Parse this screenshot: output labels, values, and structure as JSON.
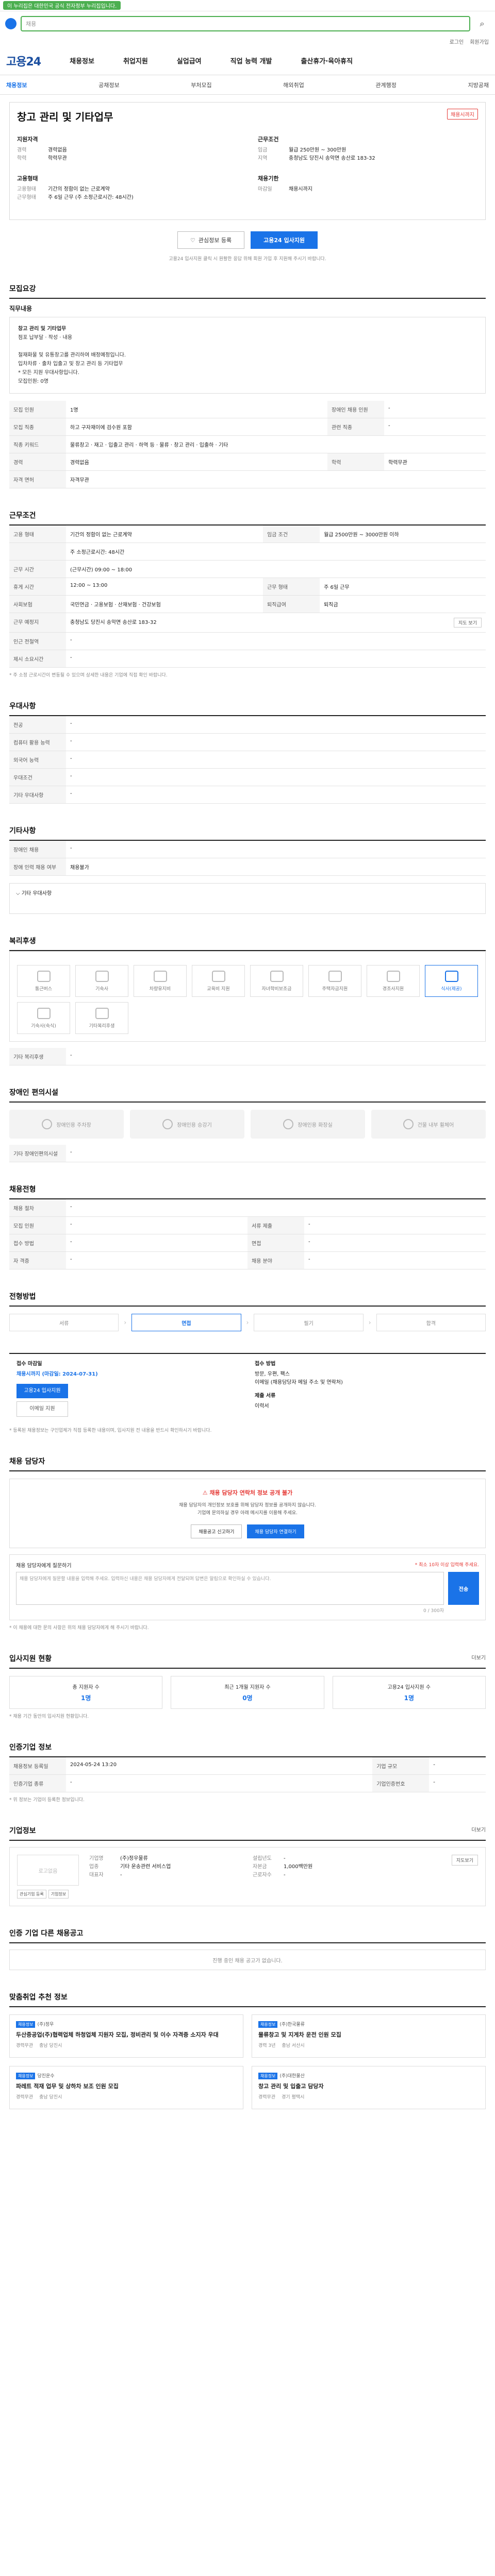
{
  "topbar": {
    "pill": "이 누리집은 대한민국 공식 전자정부 누리집입니다."
  },
  "search": {
    "placeholder": "채용"
  },
  "util": {
    "login": "로그인",
    "register": "회원가입"
  },
  "gnb": {
    "brand": "고용24",
    "menus": [
      "채용정보",
      "취업지원",
      "실업급여",
      "직업 능력 개발",
      "출산휴가·육아휴직"
    ]
  },
  "subnav": [
    "채용정보",
    "공채정보",
    "부처모집",
    "해외취업",
    "관계행정",
    "지방공채"
  ],
  "job": {
    "title": "창고 관리 및 기타업무",
    "badge": "채용시까지",
    "left_blocks": [
      {
        "head": "지원자격",
        "rows": [
          {
            "k": "경력",
            "v": "경력없음"
          },
          {
            "k": "학력",
            "v": "학력무관"
          }
        ]
      },
      {
        "head": "고용형태",
        "rows": [
          {
            "k": "고용형태",
            "v": "기간의 정함이 없는 근로계약"
          },
          {
            "k": "근무형태",
            "v": "주 6일 근무 (주 소정근로시간: 48시간)"
          }
        ]
      }
    ],
    "right_blocks": [
      {
        "head": "근무조건",
        "rows": [
          {
            "k": "임금",
            "v": "월급 250만원 ~ 300만원"
          },
          {
            "k": "지역",
            "v": "충청남도 당진시 송악면 송산로 183-32"
          }
        ]
      },
      {
        "head": "채용기한",
        "rows": [
          {
            "k": "마감일",
            "v": "채용시까지"
          }
        ]
      }
    ],
    "actions": {
      "scrap": "관심정보 등록",
      "apply": "고용24 입사지원"
    },
    "notice": "고용24 입사지원 클릭 시 원활한 응답 위해 회원 가입 후 지원해 주시기 바랍니다."
  },
  "sections": {
    "job_detail": {
      "title": "모집요강",
      "sub": "직무내용",
      "body": [
        "창고 관리 및 기타업무",
        "점포 납부달 · 작성 · 내용",
        "철재화물 및 유통창고를 관리하여 배정예정입니다.",
        "입차차류 · 출차 입출고 및 창고 관리 등 기타업무",
        "* 모든 지원 우대사항입니다.",
        "모집인원: 0명"
      ],
      "rows": [
        {
          "k": "모집 인원",
          "v": "1명",
          "k2": "장애인 채용 인원",
          "v2": "-"
        },
        {
          "k": "모집 직종",
          "v": "하고 구자재이에 검수원 포함",
          "k2": "관련 직종",
          "v2": "-"
        },
        {
          "k": "직종 키워드",
          "v": "물류창고 · 재고 · 입출고 관리 · 하역 등 · 물류 · 창고 관리 · 입출하 · 기타",
          "k2": "",
          "v2": ""
        },
        {
          "k": "경력",
          "v": "경력없음",
          "k2": "학력",
          "v2": "학력무관"
        },
        {
          "k": "자격 면허",
          "v": "자격무관",
          "k2": "",
          "v2": ""
        }
      ]
    },
    "conditions": {
      "title": "근무조건",
      "rows": [
        {
          "k": "고용 형태",
          "v": "기간의 정함이 없는 근로계약",
          "k2": "임금 조건",
          "v2": "월급 2500만원 ~ 3000만원 이하"
        },
        {
          "k": "",
          "v": "주 소정근로시간: 48시간",
          "k2": "",
          "v2": ""
        },
        {
          "k": "근무 시간",
          "v": "(근무시간) 09:00 ~ 18:00",
          "k2": "",
          "v2": ""
        },
        {
          "k": "휴게 시간",
          "v": "12:00 ~ 13:00",
          "k2": "근무 형태",
          "v2": "주 6일 근무"
        },
        {
          "k": "사회보험",
          "v": "국민연금 · 고용보험 · 산재보험 · 건강보험",
          "k2": "퇴직급여",
          "v2": "퇴직금"
        },
        {
          "k": "근무 예정지",
          "v": "충청남도 당진시 송악면 송산로 183-32",
          "k2": "",
          "v2": ""
        },
        {
          "k": "인근 전철역",
          "v": "-",
          "k2": "",
          "v2": ""
        },
        {
          "k": "제시 소요시간",
          "v": "-",
          "k2": "",
          "v2": ""
        }
      ],
      "map_btn": "지도 보기",
      "note": "* 주 소정 근로시간이 변동될 수 있으며 상세한 내용은 기업에 직접 확인 바랍니다."
    },
    "preference": {
      "title": "우대사항",
      "rows": [
        {
          "k": "전공",
          "v": "-"
        },
        {
          "k": "컴퓨터 활용 능력",
          "v": "-"
        },
        {
          "k": "외국어 능력",
          "v": "-"
        },
        {
          "k": "우대조건",
          "v": "-"
        },
        {
          "k": "기타 우대사항",
          "v": "-"
        }
      ]
    },
    "etc": {
      "title": "기타사항",
      "rows": [
        {
          "k": "장애인 채용",
          "v": "-"
        },
        {
          "k": "장애 인력 채용 여부",
          "v": "채용불가"
        }
      ],
      "toggle": "기타 우대사항"
    },
    "welfare": {
      "title": "복리후생",
      "items": [
        "통근버스",
        "기숙사",
        "차량유지비",
        "교육비 지원",
        "자녀학비보조금",
        "주택자금지원",
        "경조사지원",
        "식사(제공)"
      ],
      "items2": [
        "기숙사(숙식)",
        "기타복리후생"
      ],
      "etc_label": "기타 복리후생",
      "etc_value": "-"
    },
    "disability": {
      "title": "장애인 편의시설",
      "items": [
        "장애인용 주차장",
        "장애인용 승강기",
        "장애인용 화장실",
        "건물 내부 휠체어"
      ],
      "etc_label": "기타 장애인편의시설",
      "etc_value": "-"
    },
    "selection": {
      "title": "채용전형",
      "rows": [
        {
          "k": "채용 절차",
          "v": "-"
        },
        {
          "k": "모집 인원",
          "v": "-",
          "k2": "서류 제출",
          "v2": "-"
        },
        {
          "k": "접수 방법",
          "v": "-",
          "k2": "면접",
          "v2": "-"
        },
        {
          "k": "자 격증",
          "v": "-",
          "k2": "채용 분야",
          "v2": "-"
        }
      ]
    },
    "process": {
      "title": "전형방법",
      "steps": [
        "서류",
        "면접",
        "필기",
        "합격"
      ]
    },
    "apply": {
      "left_head": "접수 마감일",
      "left_deadline": "채용시까지 (마감일: 2024-07-31)",
      "btn1": "고용24 입사지원",
      "btn2": "이메일 지원",
      "right_head": "접수 방법",
      "right_rows": [
        "방문, 우편, 팩스",
        "이메일 (채용담당자 메일 주소 및 연락처)"
      ],
      "right_head2": "제출 서류",
      "right_value2": "이력서",
      "note": "* 등록된 채용정보는 구인업체가 직접 등록한 내용이며, 입사지원 전 내용을 반드시 확인하시기 바랍니다."
    },
    "contact": {
      "title": "채용 담당자",
      "warn_head": "채용 담당자 연락처 정보 공개 불가",
      "warn_text": [
        "채용 담당자의 개인정보 보호를 위해 담당자 정보를 공개하지 않습니다.",
        "기업에 문의하실 경우 아래 메시지를 이용해 주세요."
      ],
      "btn_a": "채용공고 신고하기",
      "btn_b": "채용 담당자 연결하기",
      "chat_label": "채용 담당자에게 질문하기",
      "chat_limit": "* 최소 10자 이상 입력해 주세요.",
      "chat_placeholder": "채용 담당자에게 질문할 내용을 입력해 주세요. 입력하신 내용은 채용 담당자에게 전달되며 답변은 알림으로 확인하실 수 있습니다.",
      "chat_send": "전송",
      "chat_count": "0 / 300자",
      "notes": [
        "* 이 채용에 대한 문의 사항은 위의 채용 담당자에게 해 주시기 바랍니다."
      ]
    },
    "stats": {
      "title": "입사지원 현황",
      "more": "더보기",
      "cards": [
        {
          "label": "총 지원자 수",
          "n": "1명"
        },
        {
          "label": "최근 1개월 지원자 수",
          "n": "0명"
        },
        {
          "label": "고용24 입사지원 수",
          "n": "1명"
        }
      ],
      "note": "* 채용 기간 동안의 입사지원 현황입니다."
    },
    "company_info": {
      "title": "인증기업 정보",
      "rows": [
        {
          "k": "채용정보 등록일",
          "v": "2024-05-24 13:20",
          "k2": "기업 규모",
          "v2": "-"
        },
        {
          "k": "인증기업 종류",
          "v": "-",
          "k2": "기업인증번호",
          "v2": "-"
        }
      ],
      "note": "* 위 정보는 기업이 등록한 정보입니다."
    },
    "company": {
      "title": "기업정보",
      "more": "더보기",
      "rows": [
        {
          "k": "기업명",
          "v": "(주)정우물류"
        },
        {
          "k": "업종",
          "v": "기타 운송관련 서비스업"
        },
        {
          "k": "대표자",
          "v": "-"
        }
      ],
      "rows2": [
        {
          "k": "설립년도",
          "v": "-"
        },
        {
          "k": "자본금",
          "v": "1,000백만원"
        },
        {
          "k": "근로자수",
          "v": "-"
        }
      ],
      "logo_text": "로고없음",
      "btns": [
        "관심기업 등록",
        "기업정보"
      ],
      "side_btns": [
        "지도보기"
      ]
    },
    "other_jobs": {
      "title": "인증 기업 다른 채용공고",
      "empty": "진행 중인 채용 공고가 없습니다."
    },
    "recommend": {
      "title": "맞춤취업 추천 정보",
      "cards": [
        {
          "tag": "채용정보",
          "co": "(주)정우",
          "title": "두산중공업(주)협력업체 하청업체 지원자 모집, 정비관리 및 이수 자격증 소지자 우대",
          "meta": [
            "경력무관",
            "충남 당진시"
          ]
        },
        {
          "tag": "채용정보",
          "co": "(주)한국물류",
          "title": "물류창고 및 지게차 운전 인원 모집",
          "meta": [
            "경력 3년",
            "충남 서산시"
          ]
        },
        {
          "tag": "채용정보",
          "co": "당진운수",
          "title": "파레트 적재 업무 및 상하차 보조 인원 모집",
          "meta": [
            "경력무관",
            "충남 당진시"
          ]
        },
        {
          "tag": "채용정보",
          "co": "(주)대한물산",
          "title": "창고 관리 및 입출고 담당자",
          "meta": [
            "경력무관",
            "경기 평택시"
          ]
        }
      ]
    }
  }
}
